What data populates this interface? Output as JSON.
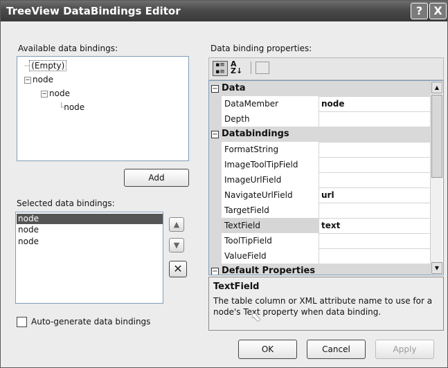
{
  "window": {
    "title": "TreeView DataBindings Editor"
  },
  "titlebar": {
    "help": "?",
    "close": "X"
  },
  "available": {
    "label": "Available data bindings:",
    "items": [
      "(Empty)",
      "node",
      "node",
      "node"
    ],
    "add": "Add"
  },
  "selected": {
    "label": "Selected data bindings:",
    "items": [
      "node",
      "node",
      "node"
    ]
  },
  "autogen": {
    "label": "Auto-generate data bindings",
    "checked": false
  },
  "properties": {
    "label": "Data binding properties:",
    "categories": {
      "data": "Data",
      "databindings": "Databindings",
      "default": "Default Properties"
    },
    "rows": [
      {
        "name": "DataMember",
        "value": "node"
      },
      {
        "name": "Depth",
        "value": ""
      },
      {
        "name": "FormatString",
        "value": ""
      },
      {
        "name": "ImageToolTipField",
        "value": ""
      },
      {
        "name": "ImageUrlField",
        "value": ""
      },
      {
        "name": "NavigateUrlField",
        "value": "url"
      },
      {
        "name": "TargetField",
        "value": ""
      },
      {
        "name": "TextField",
        "value": "text"
      },
      {
        "name": "ToolTipField",
        "value": ""
      },
      {
        "name": "ValueField",
        "value": ""
      }
    ]
  },
  "help": {
    "title": "TextField",
    "text": "The table column or XML attribute name to use for a node's Text property when data binding."
  },
  "buttons": {
    "ok": "OK",
    "cancel": "Cancel",
    "apply": "Apply"
  }
}
